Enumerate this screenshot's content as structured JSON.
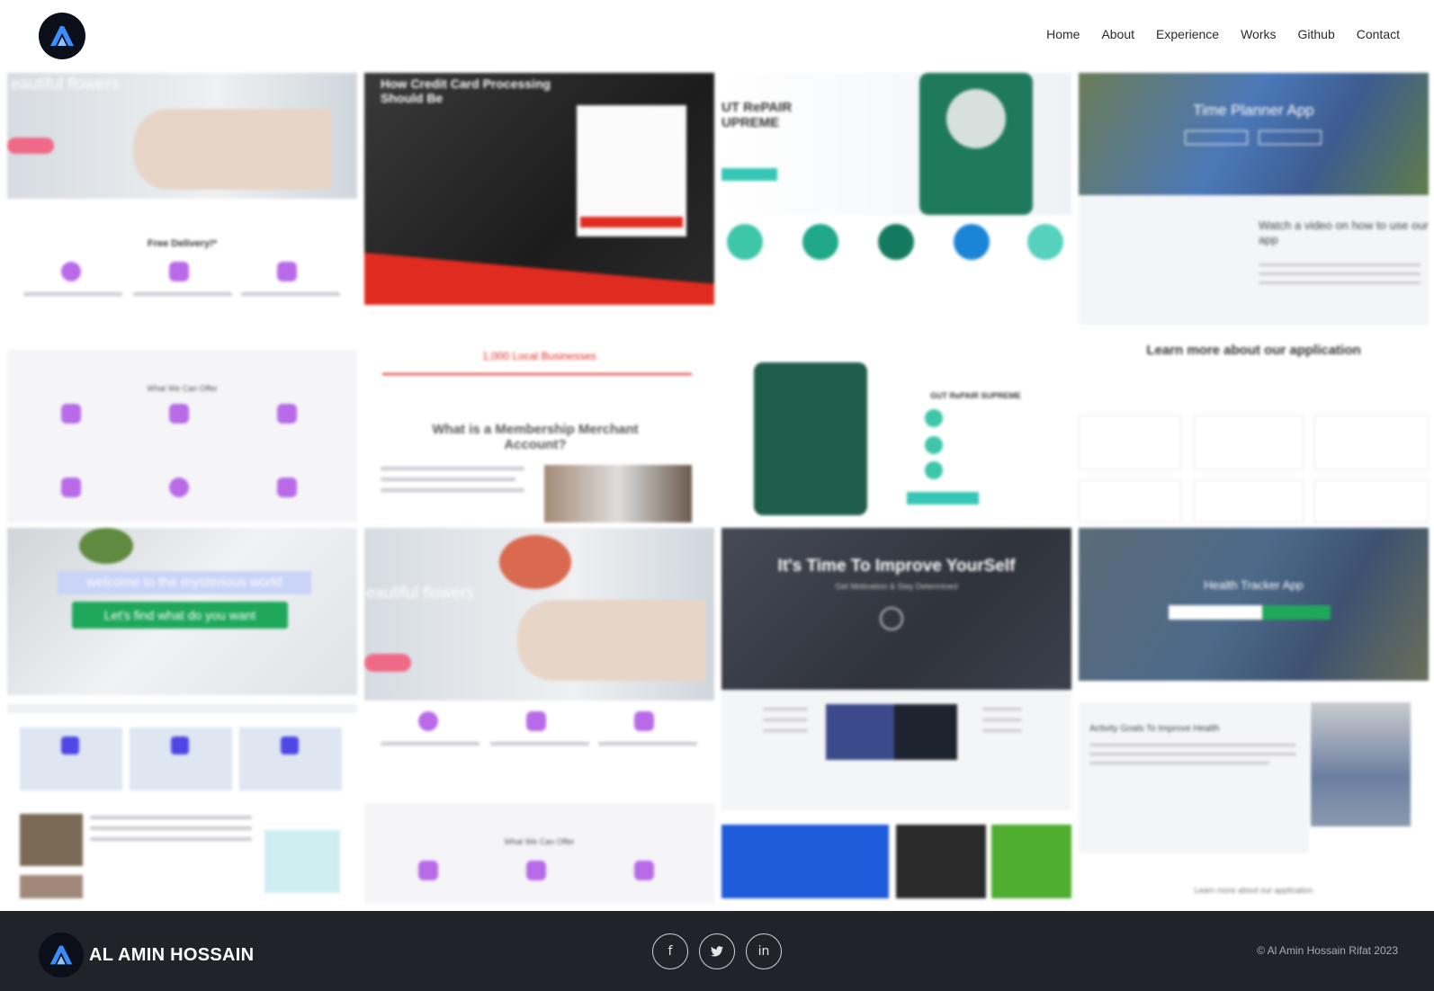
{
  "header": {
    "logo_icon": "al-amin-logo-icon",
    "nav": [
      {
        "label": "Home"
      },
      {
        "label": "About"
      },
      {
        "label": "Experience"
      },
      {
        "label": "Works"
      },
      {
        "label": "Github"
      },
      {
        "label": "Contact"
      }
    ]
  },
  "works": [
    {
      "texts": [
        "eautiful flowers",
        "Free Delivery!*",
        "What We Can Offer"
      ]
    },
    {
      "texts": [
        "How Credit Card Processing Should Be",
        "1,000 Local Businesses",
        "What is a Membership Merchant Account?"
      ]
    },
    {
      "texts": [
        "UT RePAIR UPREME",
        "GUT RePAIR SUPREME"
      ]
    },
    {
      "texts": [
        "Time Planner App",
        "Watch a video on how to use our app",
        "Learn more about our application"
      ]
    },
    {
      "texts": [
        "welcome to the mysterious world",
        "Let's find what do you want"
      ]
    },
    {
      "texts": [
        "eautiful flowers",
        "What We Can Offer"
      ]
    },
    {
      "texts": [
        "It's Time To Improve YourSelf",
        "Get Motivation & Stay Determined"
      ]
    },
    {
      "texts": [
        "Health Tracker App",
        "Activity Goals To Improve Health",
        "Learn more about our application"
      ]
    }
  ],
  "footer": {
    "brand": "AL AMIN HOSSAIN",
    "socials": [
      {
        "icon": "facebook-icon",
        "glyph": "f"
      },
      {
        "icon": "twitter-icon",
        "glyph": "🐦"
      },
      {
        "icon": "linkedin-icon",
        "glyph": "in"
      }
    ],
    "copyright": "© Al Amin Hossain Rifat 2023"
  },
  "colors": {
    "footer_bg": "#21232a",
    "accent_purple": "#a855f7",
    "accent_red": "#e02b20",
    "accent_green": "#1fa85a",
    "accent_blue": "#2f6fe0"
  }
}
